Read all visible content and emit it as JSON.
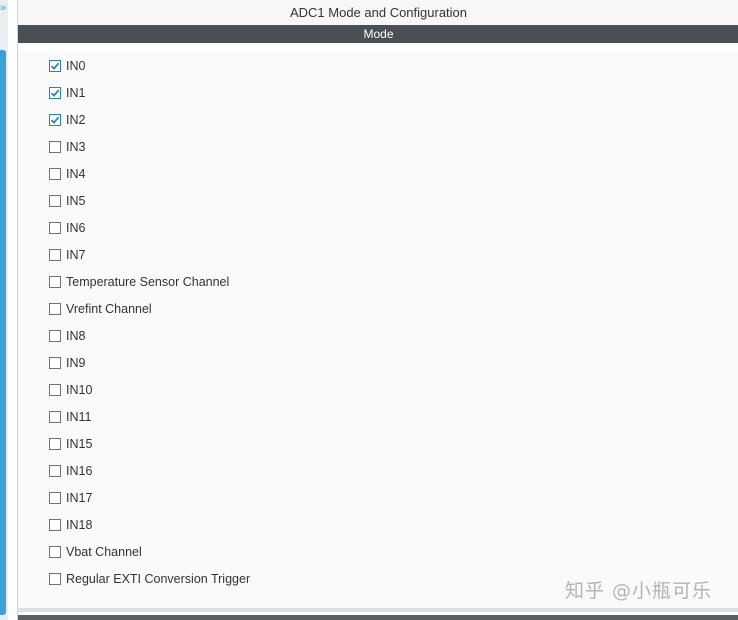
{
  "panel": {
    "title": "ADC1 Mode and Configuration",
    "section": "Mode"
  },
  "channels": [
    {
      "label": "IN0",
      "checked": true
    },
    {
      "label": "IN1",
      "checked": true
    },
    {
      "label": "IN2",
      "checked": true
    },
    {
      "label": "IN3",
      "checked": false
    },
    {
      "label": "IN4",
      "checked": false
    },
    {
      "label": "IN5",
      "checked": false
    },
    {
      "label": "IN6",
      "checked": false
    },
    {
      "label": "IN7",
      "checked": false
    },
    {
      "label": "Temperature Sensor Channel",
      "checked": false
    },
    {
      "label": "Vrefint Channel",
      "checked": false
    },
    {
      "label": "IN8",
      "checked": false
    },
    {
      "label": "IN9",
      "checked": false
    },
    {
      "label": "IN10",
      "checked": false
    },
    {
      "label": "IN11",
      "checked": false
    },
    {
      "label": "IN15",
      "checked": false
    },
    {
      "label": "IN16",
      "checked": false
    },
    {
      "label": "IN17",
      "checked": false
    },
    {
      "label": "IN18",
      "checked": false
    },
    {
      "label": "Vbat Channel",
      "checked": false
    },
    {
      "label": "Regular EXTI Conversion Trigger",
      "checked": false
    }
  ],
  "colors": {
    "header_bg": "#4a4f53",
    "check_accent": "#2b82b8",
    "sidebar_accent": "#3aa0d8"
  },
  "icons": {
    "left_arrow": "collapse-arrow-icon",
    "checkmark": "checkmark-icon"
  },
  "watermark": "知乎 @小瓶可乐"
}
